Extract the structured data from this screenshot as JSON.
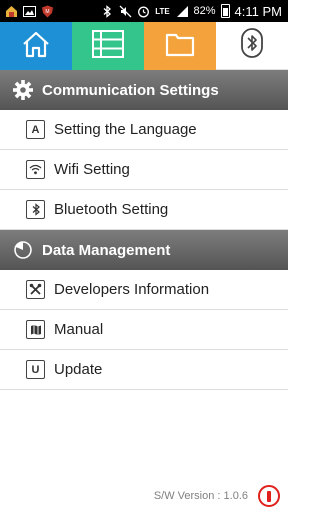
{
  "status_bar": {
    "battery_percent": "82%",
    "time": "4:11 PM",
    "network": "LTE",
    "icons": [
      "home-app-icon",
      "image-icon",
      "shield-icon",
      "bluetooth-icon",
      "mute-icon",
      "alarm-icon",
      "lte-icon",
      "signal-icon",
      "battery-icon"
    ]
  },
  "tabs": [
    {
      "name": "home",
      "icon": "home-icon",
      "color": "#1e90d6"
    },
    {
      "name": "list",
      "icon": "list-icon",
      "color": "#34c58c"
    },
    {
      "name": "folder",
      "icon": "folder-icon",
      "color": "#f3a23c"
    },
    {
      "name": "bluetooth",
      "icon": "bluetooth-icon",
      "color": "#ffffff"
    }
  ],
  "sections": [
    {
      "title": "Communication Settings",
      "icon": "gear-icon",
      "items": [
        {
          "label": "Setting the Language",
          "icon": "letter-a-icon",
          "glyph": "A"
        },
        {
          "label": "Wifi Setting",
          "icon": "wifi-icon"
        },
        {
          "label": "Bluetooth Setting",
          "icon": "bluetooth-icon"
        }
      ]
    },
    {
      "title": "Data Management",
      "icon": "pie-chart-icon",
      "items": [
        {
          "label": "Developers Information",
          "icon": "tools-icon"
        },
        {
          "label": "Manual",
          "icon": "map-icon"
        },
        {
          "label": "Update",
          "icon": "letter-u-icon",
          "glyph": "U"
        }
      ]
    }
  ],
  "footer": {
    "version": "S/W Version : 1.0.6",
    "power_color": "#e0201c"
  }
}
